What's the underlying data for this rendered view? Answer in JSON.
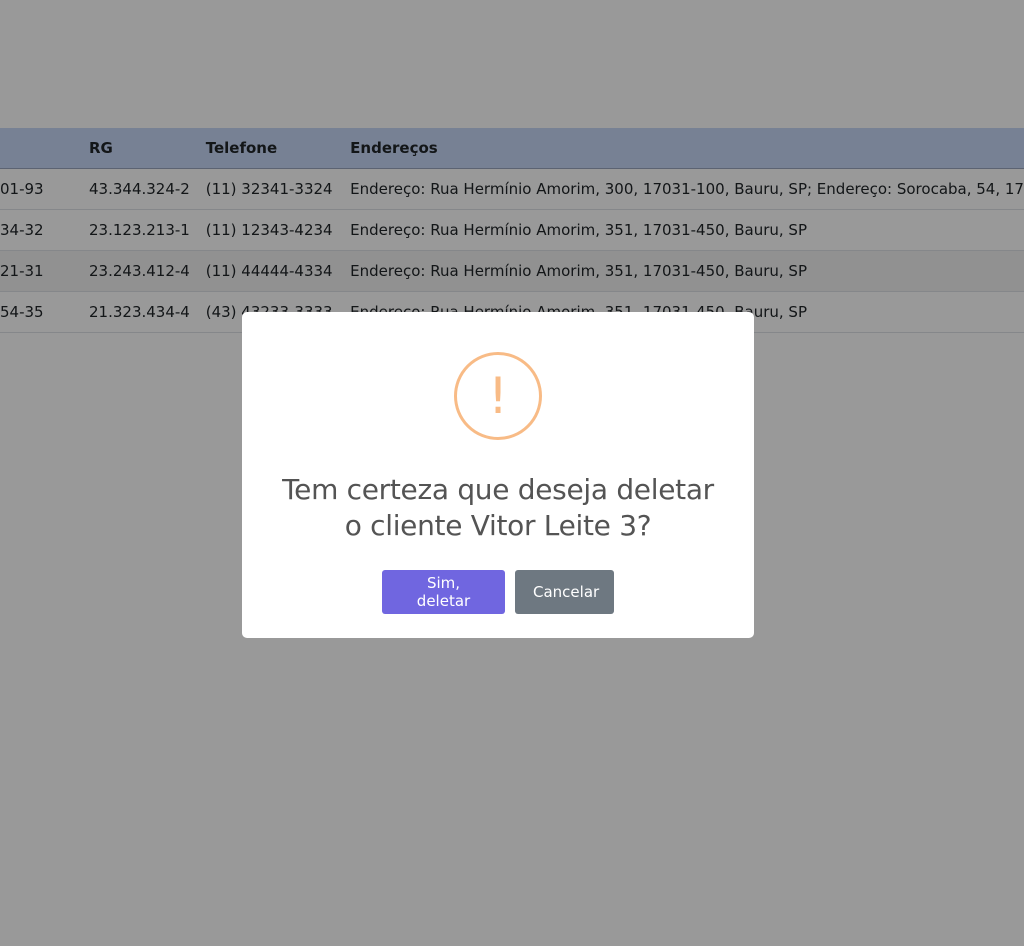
{
  "table": {
    "headers": {
      "cpf": "",
      "rg": "RG",
      "telefone": "Telefone",
      "enderecos": "Endereços"
    },
    "rows": [
      {
        "cpf": "01-93",
        "rg": "43.344.324-2",
        "telefone": "(11) 32341-3324",
        "enderecos": "Endereço: Rua Hermínio Amorim, 300, 17031-100, Bauru, SP; Endereço: Sorocaba, 54, 17"
      },
      {
        "cpf": "34-32",
        "rg": "23.123.213-1",
        "telefone": "(11) 12343-4234",
        "enderecos": "Endereço: Rua Hermínio Amorim, 351, 17031-450, Bauru, SP"
      },
      {
        "cpf": "21-31",
        "rg": "23.243.412-4",
        "telefone": "(11) 44444-4334",
        "enderecos": "Endereço: Rua Hermínio Amorim, 351, 17031-450, Bauru, SP"
      },
      {
        "cpf": "54-35",
        "rg": "21.323.434-4",
        "telefone": "(43) 43233-3333",
        "enderecos": "Endereço: Rua Hermínio Amorim, 351, 17031-450, Bauru, SP"
      }
    ]
  },
  "dialog": {
    "icon": "warning-icon",
    "icon_glyph": "!",
    "title_line1": "Tem certeza que deseja deletar",
    "title_line2": "o cliente Vitor Leite 3?",
    "confirm_label": "Sim, deletar",
    "cancel_label": "Cancelar"
  },
  "colors": {
    "overlay": "rgba(0,0,0,0.4)",
    "warning": "#f8bb86",
    "confirm": "#7066e0",
    "cancel": "#6e7881",
    "table_header": "#c7d7f7"
  }
}
